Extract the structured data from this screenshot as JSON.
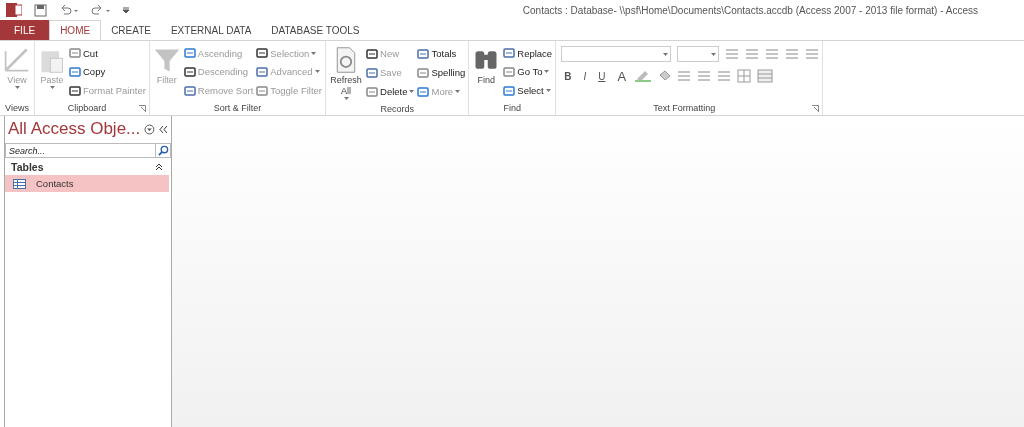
{
  "quick_access": {
    "undo_dropdown": true,
    "redo_dropdown": true
  },
  "window": {
    "title": "Contacts : Database- \\\\psf\\Home\\Documents\\Contacts.accdb (Access 2007 - 2013 file format) - Access"
  },
  "tabs": [
    {
      "label": "FILE",
      "kind": "file",
      "selected": false
    },
    {
      "label": "HOME",
      "kind": "tab",
      "selected": true
    },
    {
      "label": "CREATE",
      "kind": "tab",
      "selected": false
    },
    {
      "label": "EXTERNAL DATA",
      "kind": "tab",
      "selected": false
    },
    {
      "label": "DATABASE TOOLS",
      "kind": "tab",
      "selected": false
    }
  ],
  "ribbon": {
    "groups": [
      {
        "label": "Views",
        "launcher": false,
        "columns": [
          {
            "kind": "large",
            "items": [
              {
                "label": "View",
                "disabled": true,
                "dropdown": true
              }
            ]
          }
        ]
      },
      {
        "label": "Clipboard",
        "launcher": true,
        "columns": [
          {
            "kind": "large",
            "items": [
              {
                "label": "Paste",
                "disabled": true,
                "dropdown": true
              }
            ]
          },
          {
            "kind": "stack",
            "items": [
              {
                "label": "Cut",
                "disabled": false,
                "dropdown": false
              },
              {
                "label": "Copy",
                "disabled": false,
                "dropdown": false
              },
              {
                "label": "Format Painter",
                "disabled": true,
                "dropdown": false
              }
            ]
          }
        ]
      },
      {
        "label": "Sort & Filter",
        "launcher": false,
        "columns": [
          {
            "kind": "large",
            "items": [
              {
                "label": "Filter",
                "disabled": true,
                "dropdown": false
              }
            ]
          },
          {
            "kind": "stack",
            "items": [
              {
                "label": "Ascending",
                "disabled": true,
                "dropdown": false
              },
              {
                "label": "Descending",
                "disabled": true,
                "dropdown": false
              },
              {
                "label": "Remove Sort",
                "disabled": true,
                "dropdown": false
              }
            ]
          },
          {
            "kind": "stack",
            "items": [
              {
                "label": "Selection",
                "disabled": true,
                "dropdown": true
              },
              {
                "label": "Advanced",
                "disabled": true,
                "dropdown": true
              },
              {
                "label": "Toggle Filter",
                "disabled": true,
                "dropdown": false
              }
            ]
          }
        ]
      },
      {
        "label": "Records",
        "launcher": false,
        "columns": [
          {
            "kind": "large",
            "items": [
              {
                "label": "Refresh All",
                "disabled": false,
                "dropdown": true
              }
            ]
          },
          {
            "kind": "stack",
            "items": [
              {
                "label": "New",
                "disabled": true,
                "dropdown": false
              },
              {
                "label": "Save",
                "disabled": true,
                "dropdown": false
              },
              {
                "label": "Delete",
                "disabled": false,
                "dropdown": true
              }
            ]
          },
          {
            "kind": "stack",
            "items": [
              {
                "label": "Totals",
                "disabled": false,
                "dropdown": false
              },
              {
                "label": "Spelling",
                "disabled": false,
                "dropdown": false
              },
              {
                "label": "More",
                "disabled": true,
                "dropdown": true
              }
            ]
          }
        ]
      },
      {
        "label": "Find",
        "launcher": false,
        "columns": [
          {
            "kind": "large",
            "items": [
              {
                "label": "Find",
                "disabled": false,
                "dropdown": false
              }
            ]
          },
          {
            "kind": "stack",
            "items": [
              {
                "label": "Replace",
                "disabled": false,
                "dropdown": false
              },
              {
                "label": "Go To",
                "disabled": false,
                "dropdown": true
              },
              {
                "label": "Select",
                "disabled": false,
                "dropdown": true
              }
            ]
          }
        ]
      },
      {
        "label": "Text Formatting",
        "launcher": true,
        "columns": [
          {
            "kind": "formatting",
            "letters": [
              "B",
              "I",
              "U"
            ],
            "font_color_letter": "A"
          }
        ]
      }
    ]
  },
  "navigation": {
    "title": "All Access Obje...",
    "search": {
      "placeholder": "Search..."
    },
    "sections": [
      {
        "label": "Tables",
        "expanded": true,
        "items": [
          {
            "label": "Contacts",
            "selected": true
          }
        ]
      }
    ]
  }
}
